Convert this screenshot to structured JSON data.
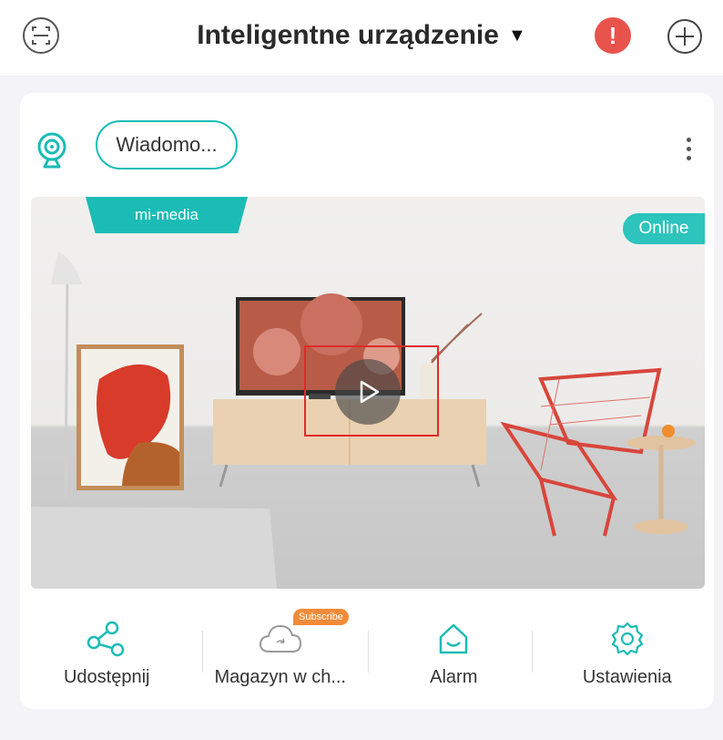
{
  "header": {
    "title": "Inteligentne urządzenie",
    "caret": "▼",
    "alert_symbol": "!",
    "icons": [
      "scan-icon",
      "alert-icon",
      "add-icon"
    ],
    "accent": "#1bbcb5",
    "alert_color": "#e8534c"
  },
  "device_card": {
    "messages_label": "Wiadomo...",
    "device_name": "mi-media",
    "status": "Online",
    "icons": [
      "camera-icon",
      "more-icon",
      "play-icon"
    ]
  },
  "actions": [
    {
      "label": "Udostępnij",
      "icon": "share-icon"
    },
    {
      "label": "Magazyn w ch...",
      "icon": "cloud-icon",
      "badge": "Subscribe"
    },
    {
      "label": "Alarm",
      "icon": "home-alarm-icon"
    },
    {
      "label": "Ustawienia",
      "icon": "gear-icon"
    }
  ]
}
